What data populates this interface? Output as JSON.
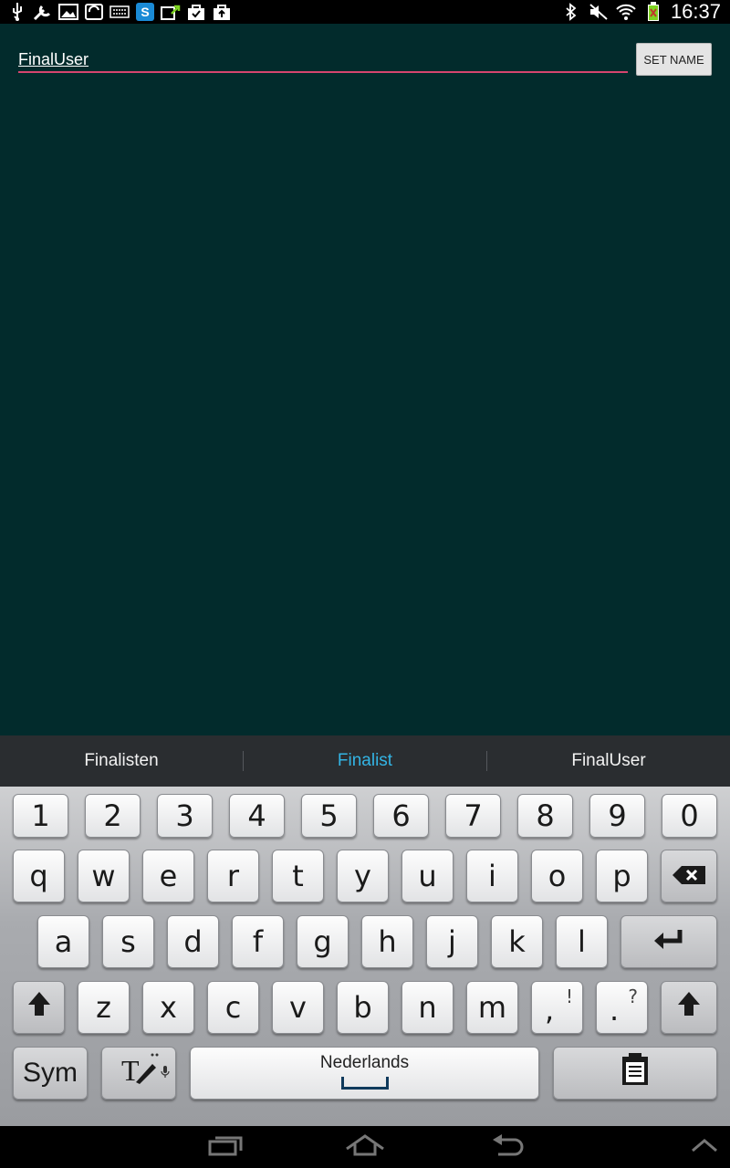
{
  "status_bar": {
    "left_icons": [
      "usb-icon",
      "wrench-icon",
      "image-icon",
      "sync-icon",
      "keyboard-icon",
      "skype-icon",
      "upload-icon",
      "bag-check-icon",
      "bag-upload-icon"
    ],
    "right_icons": [
      "bluetooth-icon",
      "mute-icon",
      "wifi-icon",
      "battery-charging-icon"
    ],
    "time": "16:37"
  },
  "app": {
    "name_input": {
      "value": "FinalUser"
    },
    "set_name_button": {
      "label": "SET NAME"
    },
    "colors": {
      "background": "#022b2c",
      "input_underline": "#d6456f"
    }
  },
  "suggestions": [
    {
      "label": "Finalisten",
      "active": false
    },
    {
      "label": "Finalist",
      "active": true
    },
    {
      "label": "FinalUser",
      "active": false
    }
  ],
  "keyboard": {
    "number_row": [
      "1",
      "2",
      "3",
      "4",
      "5",
      "6",
      "7",
      "8",
      "9",
      "0"
    ],
    "row1": [
      "q",
      "w",
      "e",
      "r",
      "t",
      "y",
      "u",
      "i",
      "o",
      "p"
    ],
    "row2": [
      "a",
      "s",
      "d",
      "f",
      "g",
      "h",
      "j",
      "k",
      "l"
    ],
    "row3": [
      "z",
      "x",
      "c",
      "v",
      "b",
      "n",
      "m"
    ],
    "comma_key": {
      "main": ",",
      "sub": "!"
    },
    "period_key": {
      "main": ".",
      "sub": "?"
    },
    "sym_label": "Sym",
    "space_label": "Nederlands"
  }
}
